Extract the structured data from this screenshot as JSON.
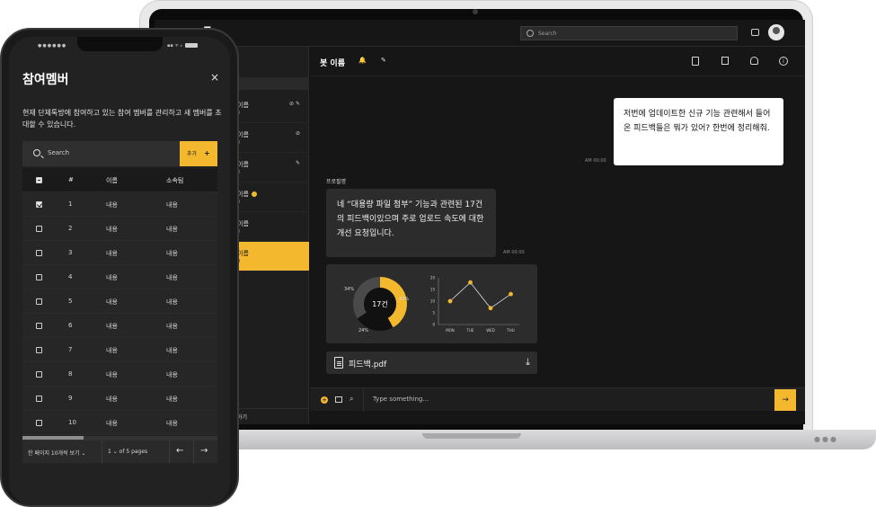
{
  "laptop": {
    "app_logo": "E",
    "search_placeholder": "Search",
    "chat_list": [
      {
        "name": "이름",
        "sub": "0",
        "icon": "⊘ ✎"
      },
      {
        "name": "이름",
        "sub": "0",
        "icon": "⊘"
      },
      {
        "name": "이름",
        "sub": "0",
        "icon": "✎"
      },
      {
        "name": "이름",
        "sub": "0",
        "icon": ""
      },
      {
        "name": "이름",
        "sub": "0",
        "icon": ""
      },
      {
        "name": "이름",
        "sub": "0",
        "icon": ""
      }
    ],
    "left_bottom_label": "하기",
    "chat": {
      "title": "봇 이름",
      "title_icons": "🔔 ✎",
      "outgoing_message": "저번에 업데이트한 신규 기능 관련해서 들어온 피드백들은 뭐가 있어? 한번에 정리해줘.",
      "outgoing_time": "AM 00:00",
      "sender_name": "프로필명",
      "incoming_message": "네 “대용량 파일 첨부” 기능과 관련된 17건의 피드백이있으며 주로 업로드 속도에 대한 개선 요청입니다.",
      "incoming_time": "AM 00:00",
      "file_name": "피드백.pdf",
      "composer_placeholder": "Type something...",
      "send_icon": "→"
    }
  },
  "chart_data": [
    {
      "type": "pie",
      "center_label": "17건",
      "slices": [
        {
          "value": 42,
          "label": "42%",
          "color": "#f4b82f"
        },
        {
          "value": 24,
          "label": "24%",
          "color": "#111111"
        },
        {
          "value": 34,
          "label": "34%",
          "color": "#4a4a4a"
        }
      ]
    },
    {
      "type": "line",
      "categories": [
        "MON",
        "TUE",
        "WED",
        "THU"
      ],
      "values": [
        10,
        18,
        7,
        13
      ],
      "yticks": [
        "20",
        "15",
        "10",
        "5",
        "0"
      ],
      "ylim": [
        0,
        20
      ],
      "color": "#f4b82f"
    }
  ],
  "phone": {
    "status_left": "●●●●●●",
    "status_right": "▪▪ ᯤ ⁎",
    "title": "참여멤버",
    "close_icon": "×",
    "description": "현재 단체톡방에 참여하고 있는 참여 멤버를 관리하고 새 멤버를 초대할 수 있습니다.",
    "search_placeholder": "Search",
    "add_label": "추가",
    "add_icon": "+",
    "columns": {
      "num": "#",
      "name": "이름",
      "team": "소속팀"
    },
    "rows": [
      {
        "num": "1",
        "name": "내용",
        "team": "내용",
        "checked": true
      },
      {
        "num": "2",
        "name": "내용",
        "team": "내용",
        "checked": false
      },
      {
        "num": "3",
        "name": "내용",
        "team": "내용",
        "checked": false
      },
      {
        "num": "4",
        "name": "내용",
        "team": "내용",
        "checked": false
      },
      {
        "num": "5",
        "name": "내용",
        "team": "내용",
        "checked": false
      },
      {
        "num": "6",
        "name": "내용",
        "team": "내용",
        "checked": false
      },
      {
        "num": "7",
        "name": "내용",
        "team": "내용",
        "checked": false
      },
      {
        "num": "8",
        "name": "내용",
        "team": "내용",
        "checked": false
      },
      {
        "num": "9",
        "name": "내용",
        "team": "내용",
        "checked": false
      },
      {
        "num": "10",
        "name": "내용",
        "team": "내용",
        "checked": false
      }
    ],
    "pager": {
      "page_size": "한 페이지 10개씩 보기 ⌄",
      "page": "1 ⌄ of 5 pages",
      "prev_icon": "←",
      "next_icon": "→"
    }
  }
}
